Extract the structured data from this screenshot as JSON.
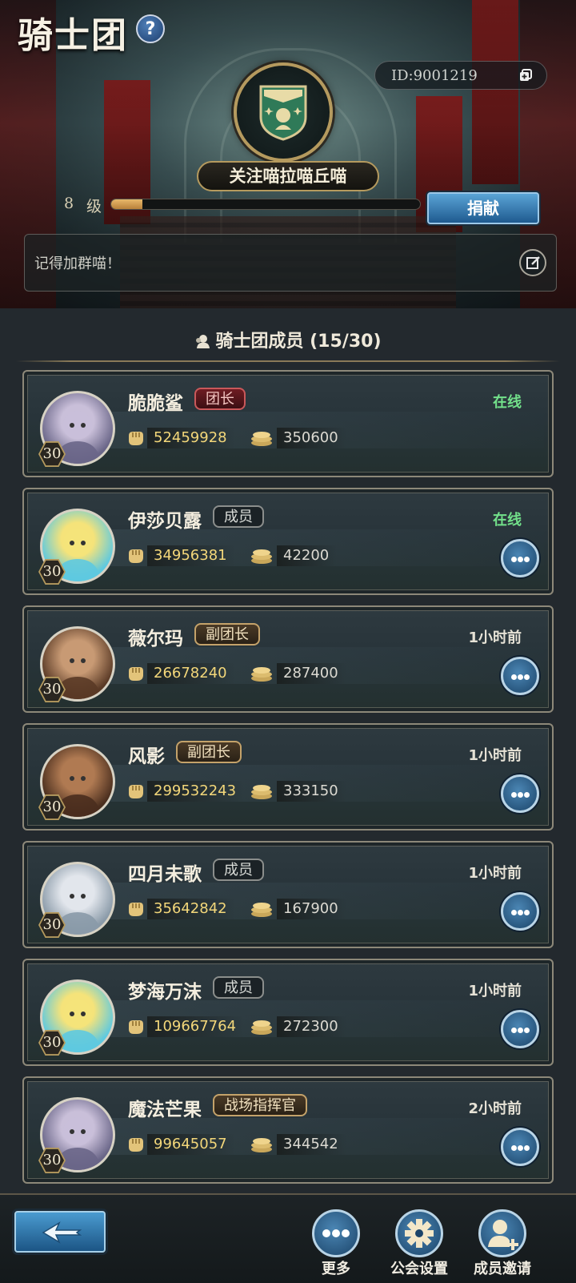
{
  "header": {
    "title": "骑士团",
    "help_label": "?",
    "id_text": "ID:9001219",
    "guild_name": "关注喵拉喵丘喵",
    "level_num": "8",
    "level_unit": "级",
    "level_progress": 0.1,
    "donate_label": "捐献",
    "notice": "记得加群喵！"
  },
  "members_section": {
    "title": "骑士团成员 (15/30)"
  },
  "members": [
    {
      "name": "脆脆鲨",
      "role": "团长",
      "role_type": "leader",
      "status": "在线",
      "status_type": "online",
      "level": "30",
      "power": "52459928",
      "contribution": "350600",
      "has_more": false,
      "avatar_colors": [
        "#6a6688",
        "#c9bfd9"
      ]
    },
    {
      "name": "伊莎贝露",
      "role": "成员",
      "role_type": "member",
      "status": "在线",
      "status_type": "online",
      "level": "30",
      "power": "34956381",
      "contribution": "42200",
      "has_more": true,
      "avatar_colors": [
        "#5ec9e0",
        "#f5e37a"
      ]
    },
    {
      "name": "薇尔玛",
      "role": "副团长",
      "role_type": "vice",
      "status": "1小时前",
      "status_type": "offline",
      "level": "30",
      "power": "26678240",
      "contribution": "287400",
      "has_more": true,
      "avatar_colors": [
        "#5a3a26",
        "#c89a74"
      ]
    },
    {
      "name": "风影",
      "role": "副团长",
      "role_type": "vice",
      "status": "1小时前",
      "status_type": "offline",
      "level": "30",
      "power": "299532243",
      "contribution": "333150",
      "has_more": true,
      "avatar_colors": [
        "#4a2e1e",
        "#b07a52"
      ]
    },
    {
      "name": "四月未歌",
      "role": "成员",
      "role_type": "member",
      "status": "1小时前",
      "status_type": "offline",
      "level": "30",
      "power": "35642842",
      "contribution": "167900",
      "has_more": true,
      "avatar_colors": [
        "#8a9aa8",
        "#e2e6ec"
      ]
    },
    {
      "name": "梦海万沫",
      "role": "成员",
      "role_type": "member",
      "status": "1小时前",
      "status_type": "offline",
      "level": "30",
      "power": "109667764",
      "contribution": "272300",
      "has_more": true,
      "avatar_colors": [
        "#5ec9e0",
        "#f5e37a"
      ]
    },
    {
      "name": "魔法芒果",
      "role": "战场指挥官",
      "role_type": "vice",
      "status": "2小时前",
      "status_type": "offline",
      "level": "30",
      "power": "99645057",
      "contribution": "344542",
      "has_more": true,
      "avatar_colors": [
        "#6a6688",
        "#c9bfd9"
      ]
    }
  ],
  "footer": {
    "more_label": "更多",
    "settings_label": "公会设置",
    "invite_label": "成员邀请"
  },
  "icons": {
    "power": "fist-icon",
    "contribution": "coin-stack-icon",
    "back": "back-arrow-icon",
    "more": "ellipsis-icon",
    "settings": "gear-icon",
    "invite": "add-member-icon"
  }
}
